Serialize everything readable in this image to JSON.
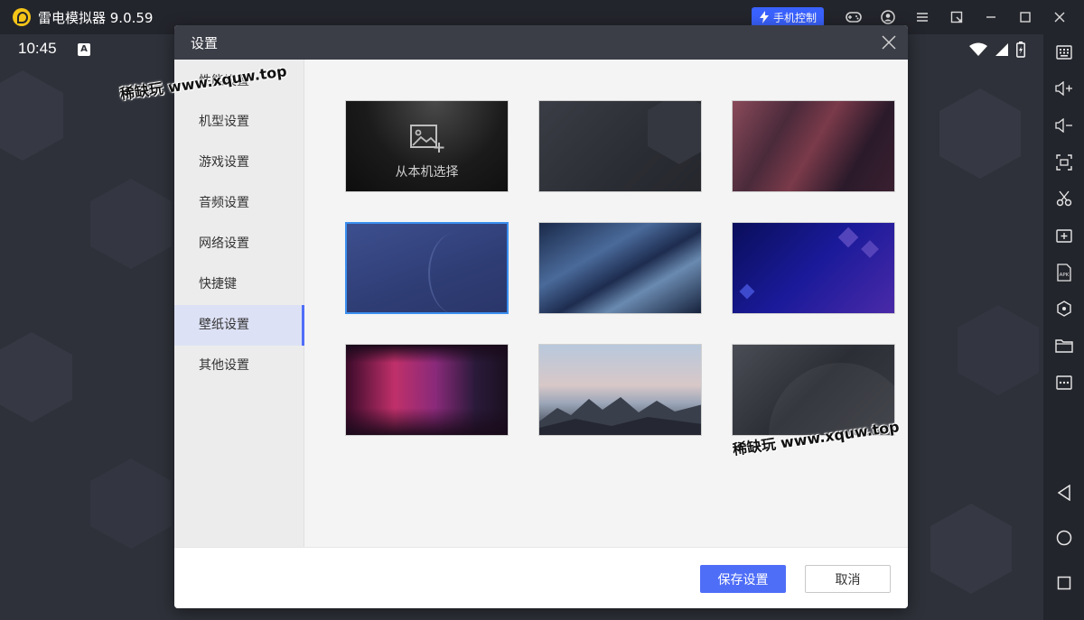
{
  "app": {
    "title": "雷电模拟器 9.0.59",
    "phone_control_label": "手机控制",
    "brand_color": "#f5c518",
    "accent_color": "#3a62ff"
  },
  "android": {
    "time": "10:45",
    "status_badge": "A"
  },
  "dialog": {
    "title": "设置",
    "nav": [
      {
        "label": "性能设置",
        "active": false
      },
      {
        "label": "机型设置",
        "active": false
      },
      {
        "label": "游戏设置",
        "active": false
      },
      {
        "label": "音频设置",
        "active": false
      },
      {
        "label": "网络设置",
        "active": false
      },
      {
        "label": "快捷键",
        "active": false
      },
      {
        "label": "壁纸设置",
        "active": true
      },
      {
        "label": "其他设置",
        "active": false
      }
    ],
    "wallpapers": {
      "local_pick_label": "从本机选择",
      "selected_index": 3,
      "count": 9
    },
    "save_label": "保存设置",
    "cancel_label": "取消"
  },
  "watermark": {
    "text": "稀缺玩 www.xquw.top"
  },
  "sidebar_icons": [
    "keyboard-icon",
    "volume-up-icon",
    "volume-down-icon",
    "screenshot-icon",
    "scissors-icon",
    "add-app-icon",
    "apk-icon",
    "operation-record-icon",
    "folder-icon",
    "more-icon",
    "back-icon",
    "home-icon",
    "recent-apps-icon"
  ]
}
